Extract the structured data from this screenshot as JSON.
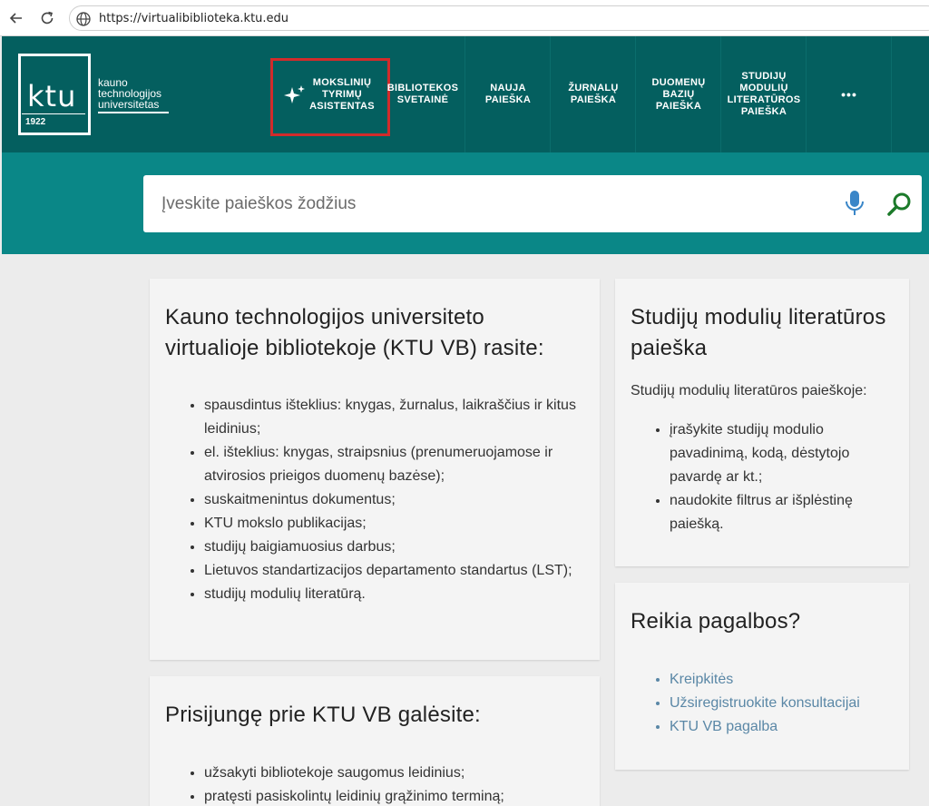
{
  "browser": {
    "url": "https://virtualibiblioteka.ktu.edu"
  },
  "logo": {
    "mark": "ktu",
    "year": "1922",
    "name_lines": [
      "kauno",
      "technologijos",
      "universitetas"
    ]
  },
  "nav": {
    "items": [
      {
        "id": "research-assistant",
        "lines": [
          "MOKSLINIŲ",
          "TYRIMŲ",
          "ASISTENTAS"
        ]
      },
      {
        "id": "library-site",
        "lines": [
          "BIBLIOTEKOS",
          "SVETAINĖ"
        ]
      },
      {
        "id": "new-search",
        "lines": [
          "NAUJA",
          "PAIEŠKA"
        ]
      },
      {
        "id": "journal-search",
        "lines": [
          "ŽURNALŲ",
          "PAIEŠKA"
        ]
      },
      {
        "id": "database-search",
        "lines": [
          "DUOMENŲ",
          "BAZIŲ",
          "PAIEŠKA"
        ]
      },
      {
        "id": "module-literature-search",
        "lines": [
          "STUDIJŲ",
          "MODULIŲ",
          "LITERATŪROS",
          "PAIEŠKA"
        ]
      }
    ],
    "more": "•••"
  },
  "search": {
    "placeholder": "Įveskite paieškos žodžius"
  },
  "main_card": {
    "title": "Kauno technologijos universiteto virtualioje bibliotekoje (KTU VB) rasite:",
    "items": [
      "spausdintus išteklius: knygas, žurnalus, laikraščius ir kitus leidinius;",
      "el. išteklius: knygas, straipsnius (prenumeruojamose ir atvirosios prieigos duomenų bazėse);",
      "suskaitmenintus dokumentus;",
      "KTU mokslo publikacijas;",
      "studijų baigiamuosius darbus;",
      "Lietuvos standartizacijos departamento standartus (LST);",
      "studijų modulių literatūrą."
    ]
  },
  "login_card": {
    "title": "Prisijungę prie KTU VB galėsite:",
    "items": [
      "užsakyti bibliotekoje saugomus leidinius;",
      "pratęsti pasiskolintų leidinių grąžinimo terminą;"
    ]
  },
  "module_card": {
    "title": "Studijų modulių literatūros paieška",
    "lead": "Studijų modulių literatūros paieškoje:",
    "items": [
      "įrašykite studijų modulio pavadinimą, kodą, dėstytojo pavardę ar kt.;",
      "naudokite filtrus ar išplėstinę paiešką."
    ]
  },
  "help_card": {
    "title": "Reikia pagalbos?",
    "links": [
      "Kreipkitės",
      "Užsiregistruokite konsultacijai",
      "KTU VB pagalba"
    ]
  },
  "colors": {
    "header": "#045f5f",
    "search_band": "#0a8787",
    "highlight": "#d22b2b",
    "link": "#5a87a6",
    "mic": "#3a86c8",
    "search_icon": "#1c7a2a"
  }
}
